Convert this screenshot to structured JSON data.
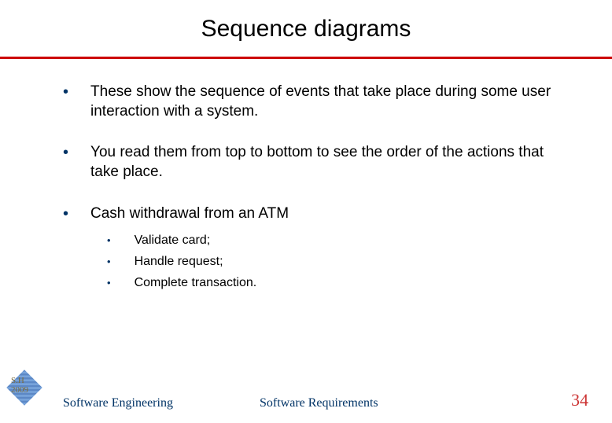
{
  "title": "Sequence diagrams",
  "bullets": [
    "These show the sequence of events that take place during some user interaction with a system.",
    "You read them from top to bottom to see the order of the actions that take place.",
    "Cash withdrawal from an ATM"
  ],
  "sub_bullets": [
    "Validate card;",
    "Handle request;",
    "Complete transaction."
  ],
  "logo": {
    "line1": "S.H",
    "line2": "2009"
  },
  "footer": {
    "left": "Software Engineering",
    "mid": "Software Requirements",
    "page": "34"
  }
}
